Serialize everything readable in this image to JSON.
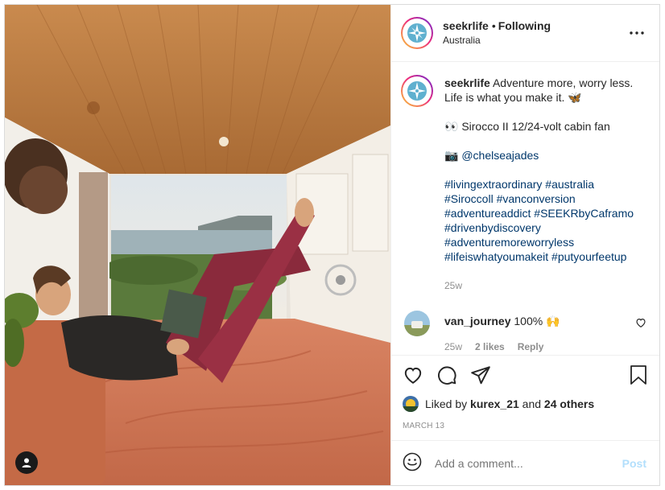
{
  "post": {
    "username": "seekrlife",
    "follow_status": "Following",
    "location": "Australia"
  },
  "caption": {
    "username": "seekrlife",
    "line1": "Adventure more, worry less.",
    "line2": "Life is what you make it. 🦋",
    "product": "👀 Sirocco II 12/24-volt cabin fan",
    "credit_icon": "📷",
    "credit_handle": "@chelseajades",
    "hashtag_lines": [
      "#livingextraordinary #australia",
      "#Siroccoll #vanconversion",
      "#adventureaddict #SEEKRbyCaframo",
      "#drivenbydiscovery",
      "#adventuremoreworryless",
      "#lifeiswhatyoumakeit #putyourfeetup"
    ],
    "age": "25w"
  },
  "comment": {
    "username": "van_journey",
    "text": "100% 🙌",
    "age": "25w",
    "likes": "2 likes",
    "reply": "Reply"
  },
  "likes": {
    "prefix": "Liked by",
    "user": "kurex_21",
    "conj": "and",
    "others": "24 others"
  },
  "date": "MARCH 13",
  "add_comment": {
    "placeholder": "Add a comment...",
    "post_label": "Post"
  },
  "icons": [
    "compass-logo-icon",
    "more-options-icon",
    "heart-icon",
    "comment-icon",
    "share-icon",
    "bookmark-icon",
    "emoji-icon",
    "tagged-user-icon"
  ],
  "colors": {
    "link": "#00376b",
    "muted": "#8e8e8e",
    "post_disabled": "#b2dffc"
  }
}
